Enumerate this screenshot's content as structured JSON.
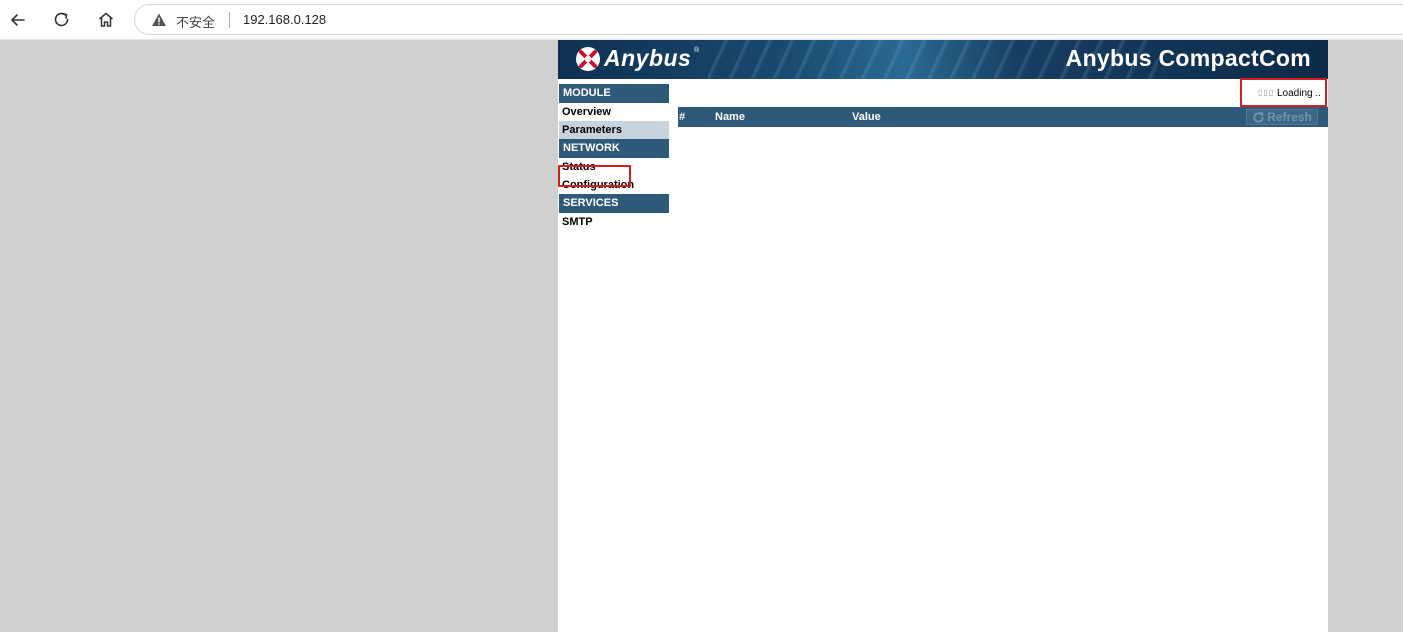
{
  "browser": {
    "security_label": "不安全",
    "url": "192.168.0.128",
    "icons": [
      "back-icon",
      "reload-icon",
      "home-icon",
      "warning-icon"
    ]
  },
  "banner": {
    "logo_text": "Anybus",
    "logo_reg": "®",
    "title": "Anybus CompactCom"
  },
  "sidebar": {
    "sections": [
      {
        "header": "MODULE",
        "items": [
          "Overview",
          "Parameters"
        ]
      },
      {
        "header": "NETWORK",
        "items": [
          "Status",
          "Configuration"
        ]
      },
      {
        "header": "SERVICES",
        "items": [
          "SMTP"
        ]
      }
    ],
    "selected": "Parameters"
  },
  "status": {
    "loading_text": "Loading ..",
    "loading_dots": "▯▯▯"
  },
  "table": {
    "columns": [
      "#",
      "Name",
      "Value"
    ],
    "refresh_label": "Refresh",
    "rows": []
  },
  "colors": {
    "header_bg": "#2f5978",
    "highlight_border": "#d21f1f",
    "selected_bg": "#c7d4de"
  }
}
